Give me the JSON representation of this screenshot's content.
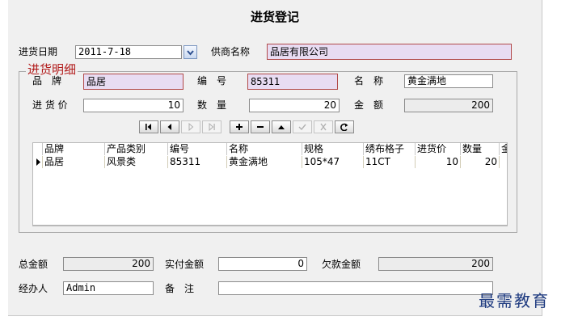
{
  "window": {
    "title": "进货登记"
  },
  "header": {
    "date_label": "进货日期",
    "date_value": "2011-7-18",
    "supplier_label": "供商名称",
    "supplier_value": "品居有限公司"
  },
  "detail": {
    "group_title": "进货明细",
    "brand_label": "品　牌",
    "brand_value": "品居",
    "code_label": "编　号",
    "code_value": "85311",
    "name_label": "名　称",
    "name_value": "黄金满地",
    "price_label": "进 货 价",
    "price_value": "10",
    "qty_label": "数　量",
    "qty_value": "20",
    "amount_label": "金　额",
    "amount_value": "200"
  },
  "navigator": {
    "buttons": [
      {
        "icon": "first-record-icon",
        "enabled": true
      },
      {
        "icon": "prior-record-icon",
        "enabled": true
      },
      {
        "icon": "next-record-icon",
        "enabled": false
      },
      {
        "icon": "last-record-icon",
        "enabled": false
      },
      {
        "icon": "insert-record-icon",
        "enabled": true
      },
      {
        "icon": "delete-record-icon",
        "enabled": true
      },
      {
        "icon": "edit-record-icon",
        "enabled": true
      },
      {
        "icon": "post-record-icon",
        "enabled": false
      },
      {
        "icon": "cancel-record-icon",
        "enabled": false
      },
      {
        "icon": "refresh-record-icon",
        "enabled": true
      }
    ]
  },
  "grid": {
    "columns": [
      "品牌",
      "产品类别",
      "编号",
      "名称",
      "规格",
      "绣布格子",
      "进货价",
      "数量",
      "金"
    ],
    "rows": [
      [
        "品居",
        "风景类",
        "85311",
        "黄金满地",
        "105*47",
        "11CT",
        "10",
        "20",
        ""
      ]
    ]
  },
  "footer": {
    "total_label": "总金额",
    "total_value": "200",
    "paid_label": "实付金额",
    "paid_value": "0",
    "owed_label": "欠款金额",
    "owed_value": "200",
    "handler_label": "经办人",
    "handler_value": "Admin",
    "note_label": "备　注",
    "note_value": ""
  },
  "watermark": {
    "text": "最需教育"
  }
}
